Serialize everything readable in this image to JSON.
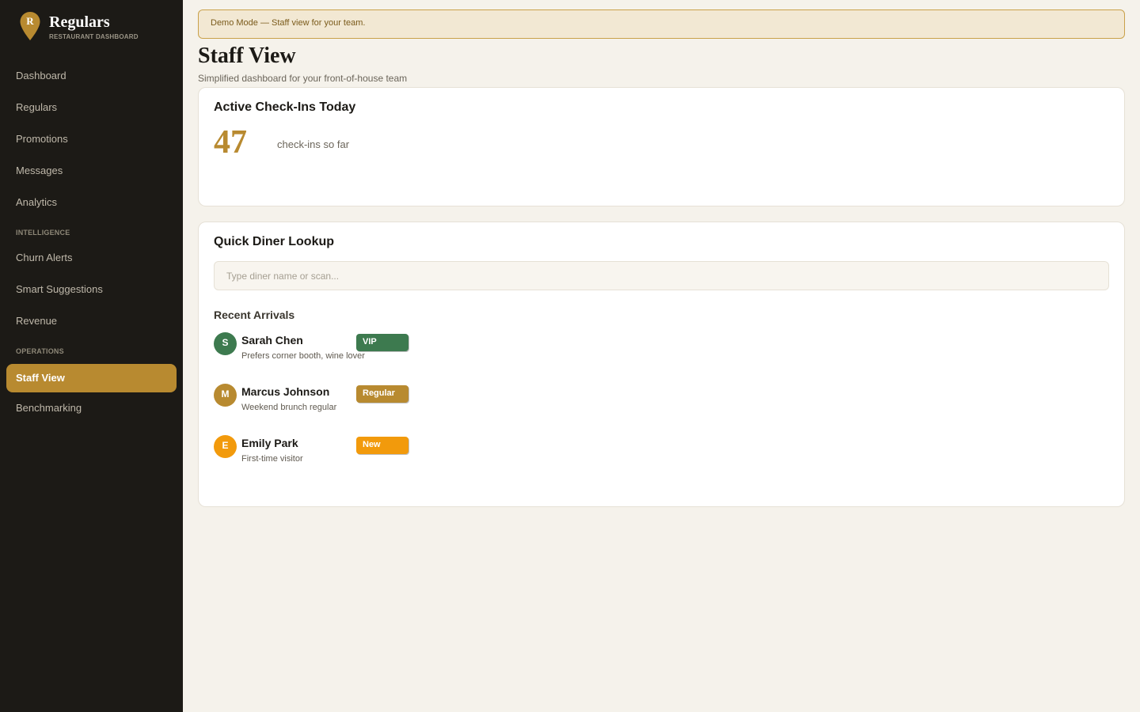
{
  "brand": {
    "initial": "R",
    "name": "Regulars",
    "subtitle": "RESTAURANT DASHBOARD",
    "accent_color": "#b88a30"
  },
  "sidebar": {
    "items": [
      {
        "label": "Dashboard"
      },
      {
        "label": "Regulars"
      },
      {
        "label": "Promotions"
      },
      {
        "label": "Messages"
      },
      {
        "label": "Analytics"
      }
    ],
    "sections": [
      {
        "title": "INTELLIGENCE",
        "items": [
          {
            "label": "Churn Alerts"
          },
          {
            "label": "Smart Suggestions"
          },
          {
            "label": "Revenue"
          }
        ]
      },
      {
        "title": "OPERATIONS",
        "items": [
          {
            "label": "Staff View",
            "active": true
          },
          {
            "label": "Benchmarking"
          }
        ]
      }
    ]
  },
  "banner": {
    "text": "Demo Mode — Staff view for your team."
  },
  "page": {
    "title": "Staff View",
    "subtitle": "Simplified dashboard for your front-of-house team"
  },
  "checkins": {
    "title": "Active Check-Ins Today",
    "count": "47",
    "label": "check-ins so far"
  },
  "lookup": {
    "title": "Quick Diner Lookup",
    "placeholder": "Type diner name or scan...",
    "value": "",
    "recent_title": "Recent Arrivals",
    "arrivals": [
      {
        "initial": "S",
        "name": "Sarah Chen",
        "note": "Prefers corner booth, wine lover",
        "badge": "VIP",
        "color": "#3d7a4f"
      },
      {
        "initial": "M",
        "name": "Marcus Johnson",
        "note": "Weekend brunch regular",
        "badge": "Regular",
        "color": "#b88a30"
      },
      {
        "initial": "E",
        "name": "Emily Park",
        "note": "First-time visitor",
        "badge": "New",
        "color": "#f29a0c"
      }
    ]
  }
}
